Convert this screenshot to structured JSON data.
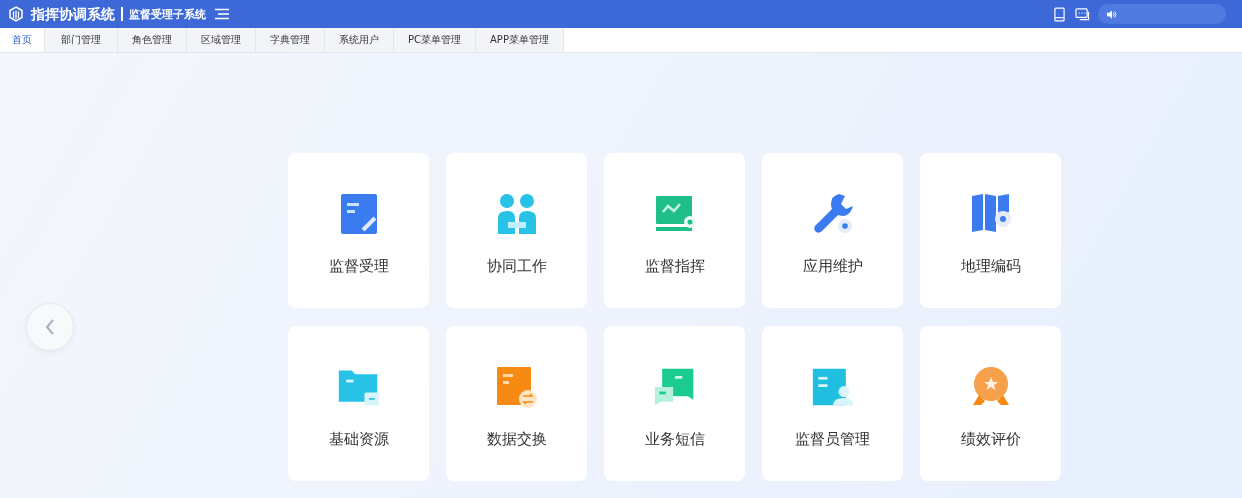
{
  "header": {
    "title": "指挥协调系统",
    "subtitle": "监督受理子系统"
  },
  "tabs": [
    {
      "label": "首页",
      "selected": true
    },
    {
      "label": "部门管理",
      "selected": false
    },
    {
      "label": "角色管理",
      "selected": false
    },
    {
      "label": "区域管理",
      "selected": false
    },
    {
      "label": "字典管理",
      "selected": false
    },
    {
      "label": "系统用户",
      "selected": false
    },
    {
      "label": "PC菜单管理",
      "selected": false
    },
    {
      "label": "APP菜单管理",
      "selected": false
    }
  ],
  "modules": [
    {
      "label": "监督受理",
      "kind": "form"
    },
    {
      "label": "协同工作",
      "kind": "people"
    },
    {
      "label": "监督指挥",
      "kind": "monitor"
    },
    {
      "label": "应用维护",
      "kind": "wrench"
    },
    {
      "label": "地理编码",
      "kind": "map"
    },
    {
      "label": "基础资源",
      "kind": "folder"
    },
    {
      "label": "数据交换",
      "kind": "exchange"
    },
    {
      "label": "业务短信",
      "kind": "chat"
    },
    {
      "label": "监督员管理",
      "kind": "staff"
    },
    {
      "label": "绩效评价",
      "kind": "medal"
    }
  ]
}
